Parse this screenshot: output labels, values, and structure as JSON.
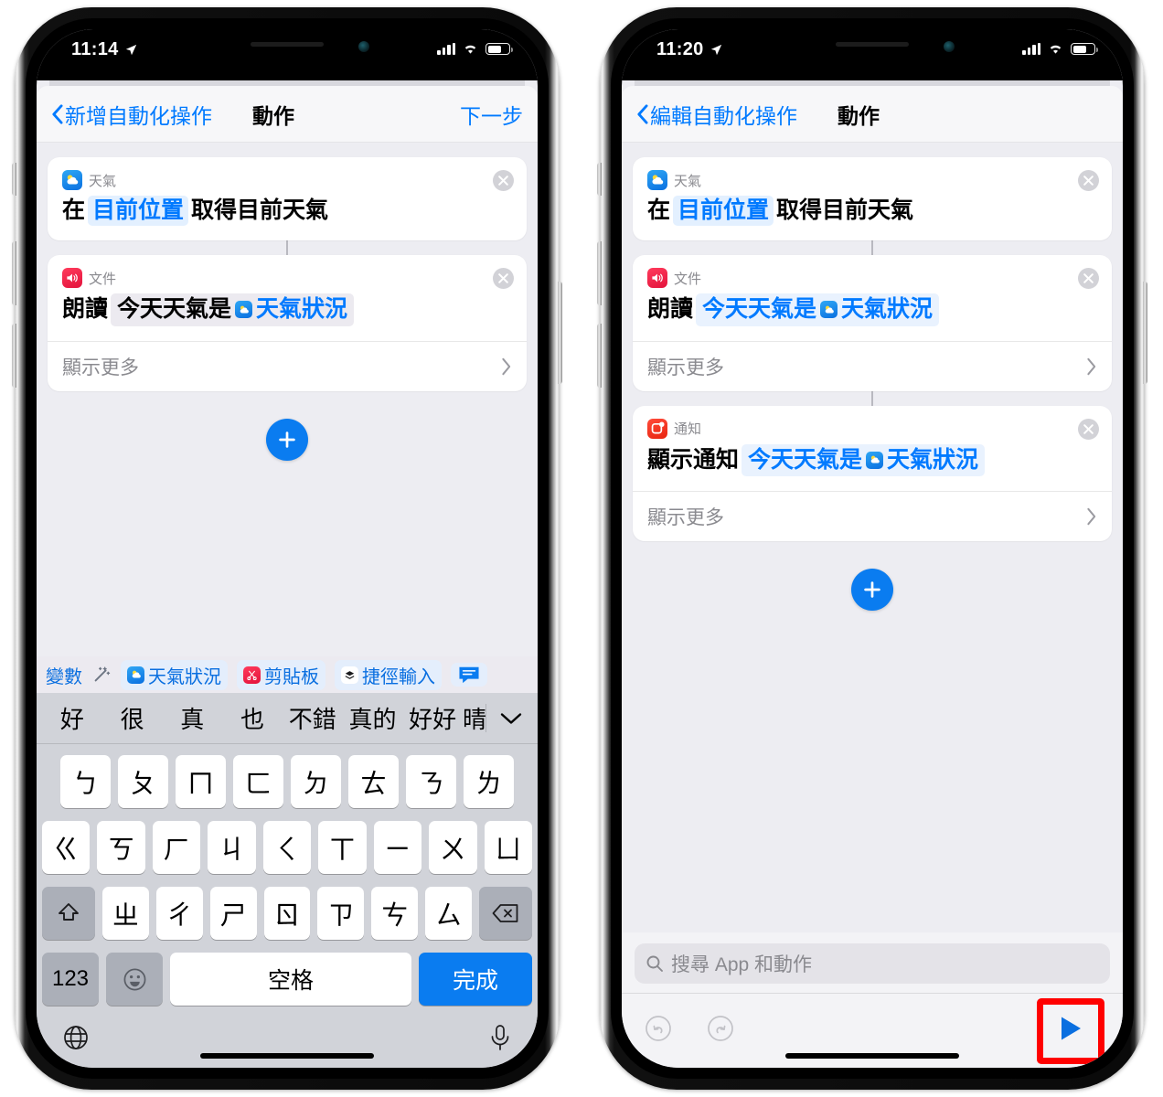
{
  "colors": {
    "accent": "#007aff",
    "accent_button": "#0a7cf0",
    "highlight_red": "#ff0000",
    "card_bg": "#ffffff",
    "screen_bg": "#ededf2"
  },
  "left_phone": {
    "status_bar": {
      "time": "11:14",
      "location_icon": "location-arrow-icon",
      "signal_icon": "cellular-bars-icon",
      "wifi_icon": "wifi-icon",
      "battery_icon": "battery-icon"
    },
    "navbar": {
      "back_label": "新增自動化操作",
      "title": "動作",
      "next_label": "下一步"
    },
    "cards": [
      {
        "app_name": "天氣",
        "app_icon": "weather-app-icon",
        "tokens": [
          {
            "type": "plain",
            "text": "在"
          },
          {
            "type": "variable",
            "text": "目前位置"
          },
          {
            "type": "plain",
            "text": "取得目前天氣"
          }
        ],
        "show_more": null,
        "close_icon": "close-circle-icon"
      },
      {
        "app_name": "文件",
        "app_icon": "speak-text-icon",
        "tokens": [
          {
            "type": "plain",
            "text": "朗讀"
          },
          {
            "type": "text-field",
            "text": "今天天氣是",
            "inline_icon": "weather-app-icon",
            "inline_variable": "天氣狀況"
          }
        ],
        "show_more": "顯示更多",
        "close_icon": "close-circle-icon"
      }
    ],
    "add_button": {
      "icon": "plus-icon"
    },
    "variable_bar": {
      "label": "變數",
      "magic_icon": "magic-wand-icon",
      "chips": [
        {
          "label": "天氣狀況",
          "icon": "weather-app-icon"
        },
        {
          "label": "剪貼板",
          "icon": "clipboard-icon"
        },
        {
          "label": "捷徑輸入",
          "icon": "shortcut-input-icon"
        },
        {
          "label": "",
          "icon": "message-bubble-icon"
        }
      ]
    },
    "keyboard": {
      "suggestions": [
        "好",
        "很",
        "真",
        "也",
        "不錯",
        "真的",
        "好好",
        "晴"
      ],
      "expand_icon": "chevron-down-icon",
      "row1": [
        "ㄅ",
        "ㄆ",
        "ㄇ",
        "ㄈ",
        "ㄉ",
        "ㄊ",
        "ㄋ",
        "ㄌ"
      ],
      "row2": [
        "ㄍ",
        "ㄎ",
        "ㄏ",
        "ㄐ",
        "ㄑ",
        "ㄒ",
        "ㄧ",
        "ㄨ",
        "ㄩ"
      ],
      "row3": [
        "ㄓ",
        "ㄔ",
        "ㄕ",
        "ㄖ",
        "ㄗ",
        "ㄘ",
        "ㄙ"
      ],
      "shift_icon": "shift-icon",
      "delete_icon": "backspace-icon",
      "numbers_label": "123",
      "emoji_icon": "emoji-icon",
      "space_label": "空格",
      "done_label": "完成",
      "globe_icon": "globe-icon",
      "mic_icon": "microphone-icon"
    }
  },
  "right_phone": {
    "status_bar": {
      "time": "11:20",
      "location_icon": "location-arrow-icon",
      "signal_icon": "cellular-bars-icon",
      "wifi_icon": "wifi-icon",
      "battery_icon": "battery-icon"
    },
    "navbar": {
      "back_label": "編輯自動化操作",
      "title": "動作"
    },
    "cards": [
      {
        "app_name": "天氣",
        "app_icon": "weather-app-icon",
        "tokens": [
          {
            "type": "plain",
            "text": "在"
          },
          {
            "type": "variable",
            "text": "目前位置"
          },
          {
            "type": "plain",
            "text": "取得目前天氣"
          }
        ],
        "show_more": null,
        "close_icon": "close-circle-icon"
      },
      {
        "app_name": "文件",
        "app_icon": "speak-text-icon",
        "tokens": [
          {
            "type": "plain",
            "text": "朗讀"
          },
          {
            "type": "text-field-blue",
            "text": "今天天氣是",
            "inline_icon": "weather-app-icon",
            "inline_variable": "天氣狀況"
          }
        ],
        "show_more": "顯示更多",
        "close_icon": "close-circle-icon"
      },
      {
        "app_name": "通知",
        "app_icon": "notification-app-icon",
        "tokens": [
          {
            "type": "plain",
            "text": "顯示通知"
          },
          {
            "type": "text-field-blue",
            "text": "今天天氣是",
            "inline_icon": "weather-app-icon",
            "inline_variable": "天氣狀況"
          }
        ],
        "show_more": "顯示更多",
        "close_icon": "close-circle-icon"
      }
    ],
    "add_button": {
      "icon": "plus-icon"
    },
    "search": {
      "placeholder": "搜尋 App 和動作",
      "icon": "search-icon"
    },
    "toolbar": {
      "undo_icon": "undo-icon",
      "redo_icon": "redo-icon",
      "play_icon": "play-icon",
      "play_highlighted": true
    }
  }
}
